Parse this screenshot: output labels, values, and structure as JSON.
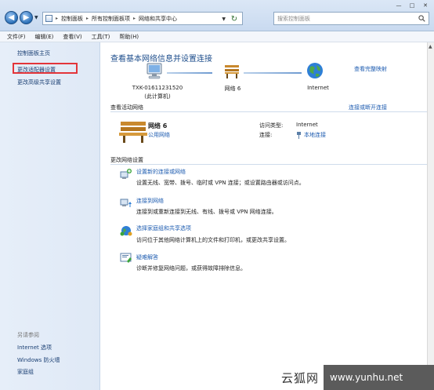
{
  "address_bar": {
    "crumbs": [
      "控制面板",
      "所有控制面板项",
      "网络和共享中心"
    ],
    "search_placeholder": "搜索控制面板"
  },
  "menu": [
    "文件(F)",
    "编辑(E)",
    "查看(V)",
    "工具(T)",
    "帮助(H)"
  ],
  "sidebar": {
    "home": "控制面板主页",
    "adapter_settings": "更改适配器设置",
    "advanced_sharing": "更改高级共享设置",
    "see_also": "另请参阅",
    "internet_options": "Internet 选项",
    "firewall": "Windows 防火墙",
    "homegroup": "家庭组"
  },
  "main": {
    "title": "查看基本网络信息并设置连接",
    "view_full_map": "查看完整映射",
    "map": {
      "computer_name": "TXK-01611231520",
      "computer_sub": "(此计算机)",
      "network": "网络  6",
      "internet": "Internet"
    },
    "active_networks_heading": "查看活动网络",
    "connect_or_disconnect": "连接或断开连接",
    "active": {
      "name": "网络  6",
      "type": "公用网络",
      "access_type_label": "访问类型:",
      "access_type_value": "Internet",
      "connection_label": "连接:",
      "connection_value": "本地连接"
    },
    "change_settings_heading": "更改网络设置",
    "tasks": [
      {
        "title": "设置新的连接或网络",
        "desc": "设置无线、宽带、拨号、临时或 VPN 连接；或设置路由器或访问点。"
      },
      {
        "title": "连接到网络",
        "desc": "连接到或重新连接到无线、有线、拨号或 VPN 网络连接。"
      },
      {
        "title": "选择家庭组和共享选项",
        "desc": "访问位于其他网络计算机上的文件和打印机，或更改共享设置。"
      },
      {
        "title": "疑难解答",
        "desc": "诊断并修复网络问题，或获得故障排除信息。"
      }
    ]
  },
  "watermark": {
    "name": "云狐网",
    "url": "www.yunhu.net"
  },
  "colors": {
    "link": "#1e5cb0",
    "title": "#1e4e8c",
    "highlight": "#e3353a"
  }
}
